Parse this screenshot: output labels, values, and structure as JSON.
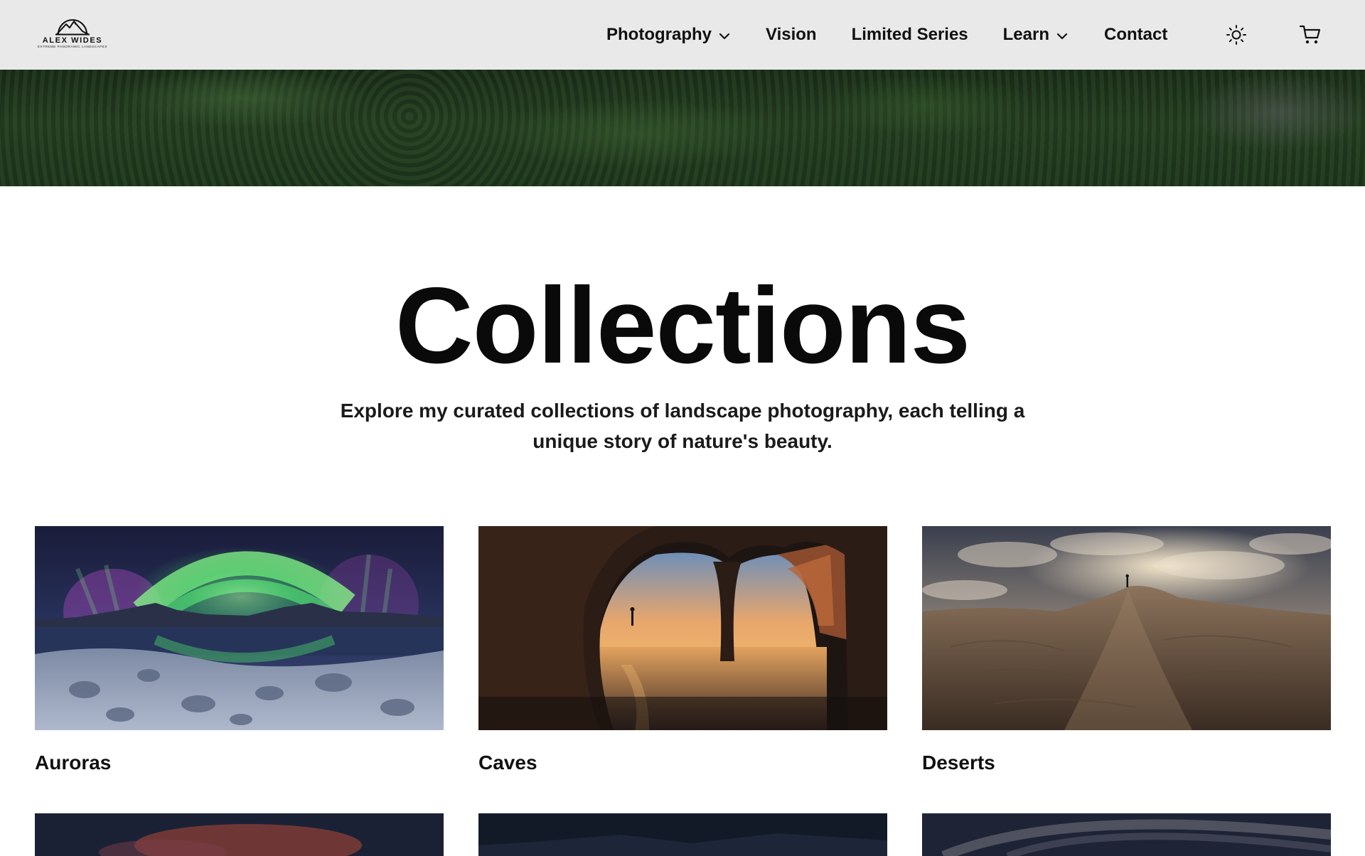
{
  "brand": {
    "name": "ALEX WIDES",
    "tagline": "EXTREME PANORAMIC LANDSCAPES"
  },
  "nav": {
    "items": [
      {
        "label": "Photography",
        "has_dropdown": true
      },
      {
        "label": "Vision",
        "has_dropdown": false
      },
      {
        "label": "Limited Series",
        "has_dropdown": false
      },
      {
        "label": "Learn",
        "has_dropdown": true
      },
      {
        "label": "Contact",
        "has_dropdown": false
      }
    ],
    "icons": [
      "sun-icon",
      "cart-icon"
    ]
  },
  "page": {
    "title": "Collections",
    "subtitle_line1": "Explore my curated collections of landscape photography, each telling a",
    "subtitle_line2": "unique story of nature's beauty."
  },
  "collections": [
    {
      "label": "Auroras"
    },
    {
      "label": "Caves"
    },
    {
      "label": "Deserts"
    },
    {
      "label": ""
    },
    {
      "label": ""
    },
    {
      "label": ""
    }
  ],
  "colors": {
    "nav_background": "#e9e9e9",
    "text": "#111111",
    "background": "#ffffff"
  }
}
